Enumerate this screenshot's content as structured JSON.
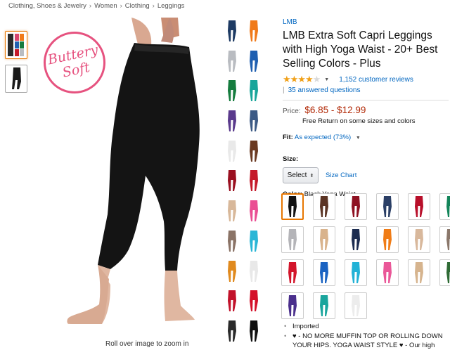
{
  "breadcrumb": [
    "Clothing, Shoes & Jewelry",
    "Women",
    "Clothing",
    "Leggings"
  ],
  "badge": {
    "line1": "Buttery",
    "line2": "Soft"
  },
  "zoom_hint": "Roll over image to zoom in",
  "product": {
    "brand": "LMB",
    "title": "LMB Extra Soft Capri Leggings with High Yoga Waist - 20+ Best Selling Colors - Plus",
    "rating_stars": 4.5,
    "reviews_text": "1,152 customer reviews",
    "answered_text": "35 answered questions",
    "price_label": "Price:",
    "price": "$6.85 - $12.99",
    "free_return": "Free Return on some sizes and colors",
    "fit_label": "Fit:",
    "fit_value": "As expected (73%)",
    "size_label": "Size:",
    "size_select": "Select",
    "size_chart": "Size Chart",
    "color_label": "Color:",
    "color_value": "Black Yoga Waist"
  },
  "strip_left_colors": [
    "#1d3a63",
    "#b9bcc1",
    "#157c3e",
    "#5a3a8c",
    "#e9e9e9",
    "#9a1020",
    "#d8b89a",
    "#8a7366",
    "#e08a1e",
    "#c2122a",
    "#2a2a2a"
  ],
  "strip_right_colors": [
    "#f07a1a",
    "#1f5fb0",
    "#18a59a",
    "#3c5a85",
    "#6b3a22",
    "#c51a2a",
    "#ea4f93",
    "#2ab6d6",
    "#e8e8e8",
    "#d4112a",
    "#111111"
  ],
  "swatch_colors": [
    "#111111",
    "#5b3424",
    "#8e1122",
    "#2b3f66",
    "#b80f2a",
    "#13855a",
    "#b4b4b8",
    "#d9b38c",
    "#1c2c50",
    "#f07c16",
    "#d8b89c",
    "#8a776a",
    "#d3152b",
    "#1a63c2",
    "#22b2d6",
    "#ea5798",
    "#d6b48e",
    "#2f6b35",
    "#4a2f8c",
    "#1aa59d",
    "#ececec"
  ],
  "bullets": [
    "Imported",
    "♥ - NO MORE MUFFIN TOP OR ROLLING DOWN YOUR HIPS. YOGA WAIST STYLE ♥ - Our high"
  ]
}
